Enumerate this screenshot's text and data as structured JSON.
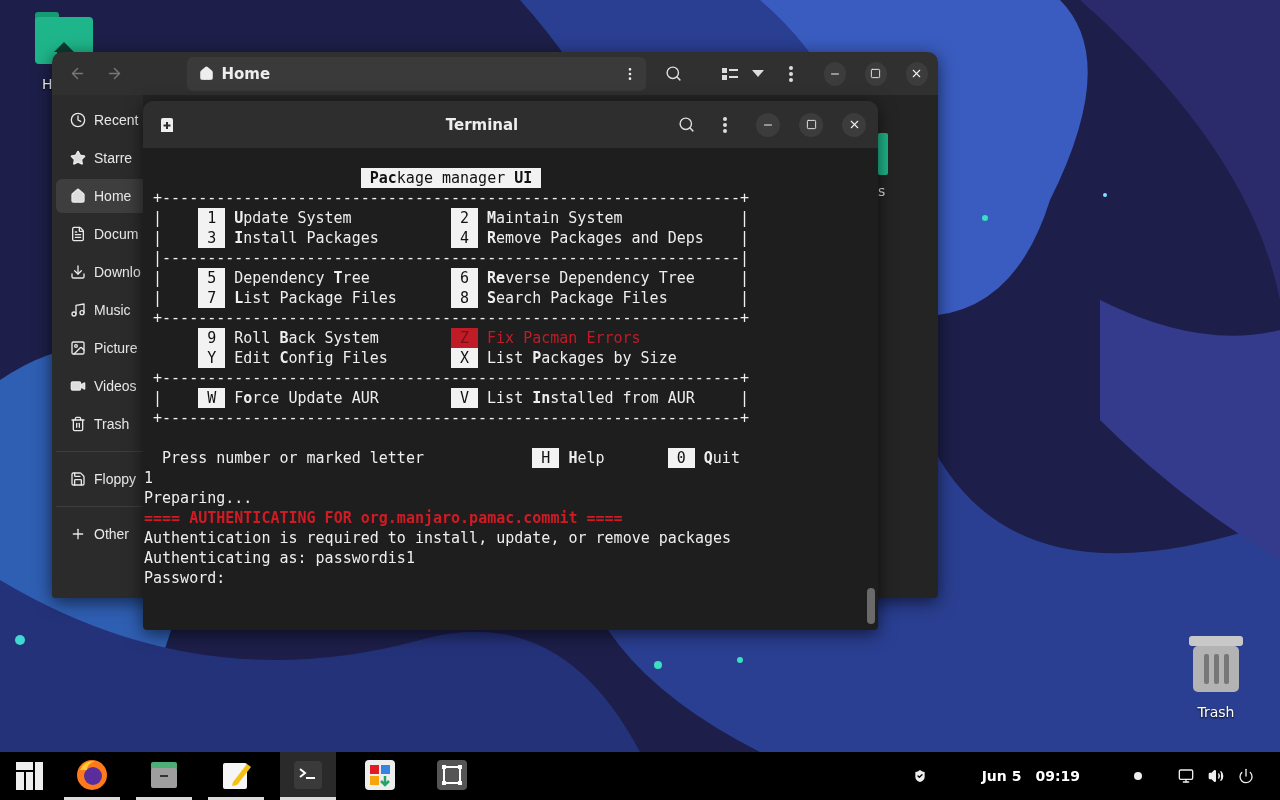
{
  "desktop_icons": [
    {
      "kind": "home_folder",
      "label": "H"
    },
    {
      "kind": "trash",
      "label": "Trash"
    }
  ],
  "file_manager": {
    "path": "Home",
    "sections": [
      {
        "items": [
          {
            "kind": "recent",
            "label": "Recent",
            "selected": false
          },
          {
            "kind": "starred",
            "label": "Starre",
            "selected": false
          },
          {
            "kind": "home",
            "label": "Home",
            "selected": true
          },
          {
            "kind": "documents",
            "label": "Docum",
            "selected": false
          },
          {
            "kind": "downloads",
            "label": "Downlo",
            "selected": false
          },
          {
            "kind": "music",
            "label": "Music",
            "selected": false
          },
          {
            "kind": "pictures",
            "label": "Picture",
            "selected": false
          },
          {
            "kind": "videos",
            "label": "Videos",
            "selected": false
          },
          {
            "kind": "trash",
            "label": "Trash",
            "selected": false
          }
        ]
      },
      {
        "items": [
          {
            "kind": "floppy",
            "label": "Floppy",
            "selected": false
          }
        ]
      },
      {
        "items": [
          {
            "kind": "other",
            "label": "Other",
            "selected": false
          }
        ]
      }
    ],
    "files": [
      {
        "label": "s"
      }
    ]
  },
  "terminal": {
    "title": "Terminal",
    "header": "**Pac**kage manager **UI**",
    "menu": [
      {
        "kind": "rule",
        "text": "+----------------------------------------------------------------+"
      },
      {
        "kind": "row",
        "left_bar": "|",
        "right_bar": "|",
        "left": {
          "key": "1",
          "label": "**U**pdate System",
          "highlight": false
        },
        "right": {
          "key": "2",
          "label": "**M**aintain System",
          "highlight": false
        }
      },
      {
        "kind": "row",
        "left_bar": "|",
        "right_bar": "|",
        "left": {
          "key": "3",
          "label": "**I**nstall Packages",
          "highlight": false
        },
        "right": {
          "key": "4",
          "label": "**R**emove Packages and Deps",
          "highlight": false
        }
      },
      {
        "kind": "rule",
        "text": "|----------------------------------------------------------------|"
      },
      {
        "kind": "row",
        "left_bar": "|",
        "right_bar": "|",
        "left": {
          "key": "5",
          "label": "Dependency **T**ree",
          "highlight": false
        },
        "right": {
          "key": "6",
          "label": "**Re**verse Dependency Tree",
          "highlight": false
        }
      },
      {
        "kind": "row",
        "left_bar": "|",
        "right_bar": "|",
        "left": {
          "key": "7",
          "label": "**L**ist Package Files",
          "highlight": false
        },
        "right": {
          "key": "8",
          "label": "**S**earch Package Files",
          "highlight": false
        }
      },
      {
        "kind": "rule",
        "text": "+----------------------------------------------------------------+"
      },
      {
        "kind": "row",
        "left": {
          "key": "9",
          "label": "Roll **B**ack System",
          "highlight": false
        },
        "right": {
          "key": "Z",
          "label": "Fix Pacman Errors",
          "highlight": true
        }
      },
      {
        "kind": "row",
        "left": {
          "key": "Y",
          "label": "Edit **C**onfig Files",
          "highlight": false
        },
        "right": {
          "key": "X",
          "label": "List **P**ackages by Size",
          "highlight": false
        }
      },
      {
        "kind": "rule",
        "text": "+----------------------------------------------------------------+"
      },
      {
        "kind": "row",
        "left_bar": "|",
        "right_bar": "|",
        "left": {
          "key": "W",
          "label": "F**o**rce Update AUR",
          "highlight": false
        },
        "right": {
          "key": "V",
          "label": "List **In**stalled from AUR",
          "highlight": false
        }
      },
      {
        "kind": "rule",
        "text": "+----------------------------------------------------------------+"
      }
    ],
    "prompt": {
      "text": "Press number or marked letter",
      "keys": [
        {
          "key": "H",
          "label": "**H**elp"
        },
        {
          "key": "0",
          "label": "**Q**uit"
        }
      ]
    },
    "output": [
      {
        "kind": "plain",
        "text": "1"
      },
      {
        "kind": "plain",
        "text": "Preparing..."
      },
      {
        "kind": "error",
        "text": "==== AUTHENTICATING FOR org.manjaro.pamac.commit ===="
      },
      {
        "kind": "plain",
        "text": "Authentication is required to install, update, or remove packages"
      },
      {
        "kind": "plain",
        "text": "Authenticating as: passwordis1"
      },
      {
        "kind": "plain",
        "text": "Password:"
      }
    ]
  },
  "taskbar": {
    "apps": [
      {
        "kind": "firefox",
        "running": true,
        "active": false
      },
      {
        "kind": "files",
        "running": true,
        "active": false
      },
      {
        "kind": "editor",
        "running": true,
        "active": false
      },
      {
        "kind": "terminal",
        "running": true,
        "active": true
      },
      {
        "kind": "software",
        "running": false,
        "active": false
      },
      {
        "kind": "screenshot",
        "running": false,
        "active": false
      }
    ],
    "date": "Jun 5",
    "time": "09:19"
  }
}
